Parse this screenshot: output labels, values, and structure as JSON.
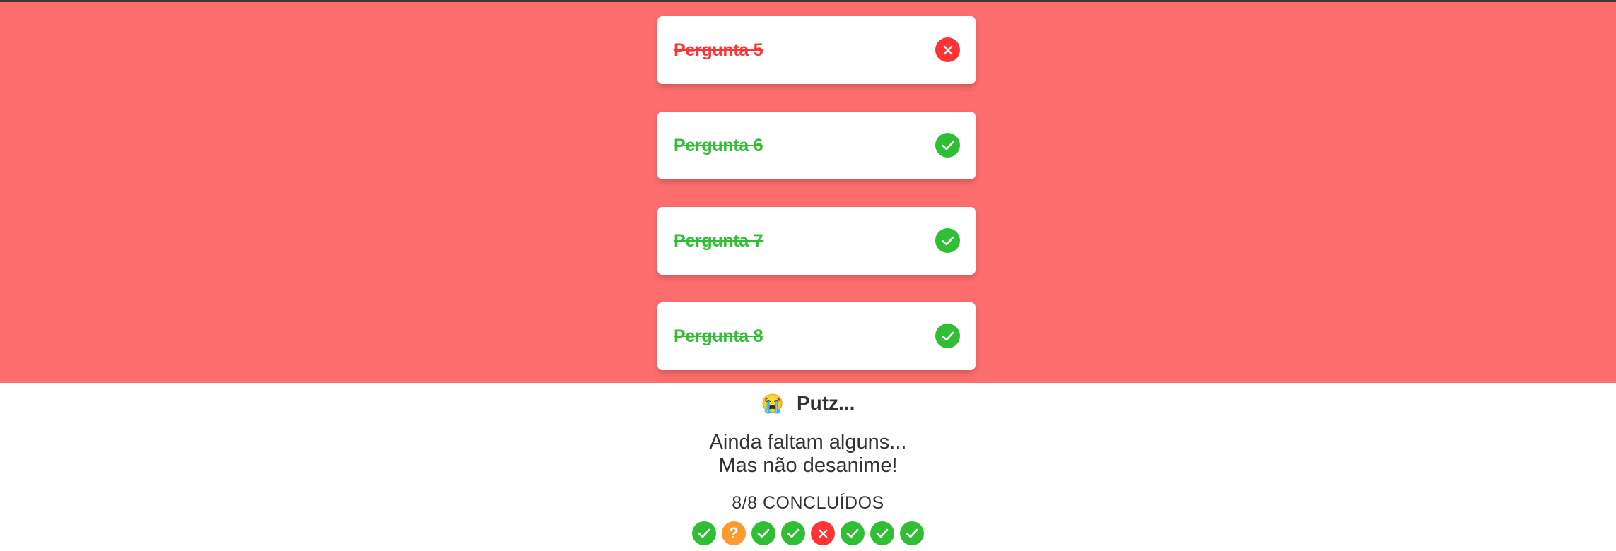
{
  "questions": [
    {
      "label": "Pergunta 5",
      "status": "wrong"
    },
    {
      "label": "Pergunta 6",
      "status": "correct"
    },
    {
      "label": "Pergunta 7",
      "status": "correct"
    },
    {
      "label": "Pergunta 8",
      "status": "correct"
    }
  ],
  "result": {
    "emoji": "😭",
    "title": "Putz...",
    "line1": "Ainda faltam alguns...",
    "line2": "Mas não desanime!",
    "count": "8/8 CONCLUÍDOS",
    "question_mark": "?",
    "progress": [
      "correct",
      "unanswered",
      "correct",
      "correct",
      "wrong",
      "correct",
      "correct",
      "correct"
    ]
  },
  "colors": {
    "background": "#fd6d6d",
    "correct": "#2fbe34",
    "wrong": "#ff3333",
    "unanswered": "#fc9a2e"
  }
}
